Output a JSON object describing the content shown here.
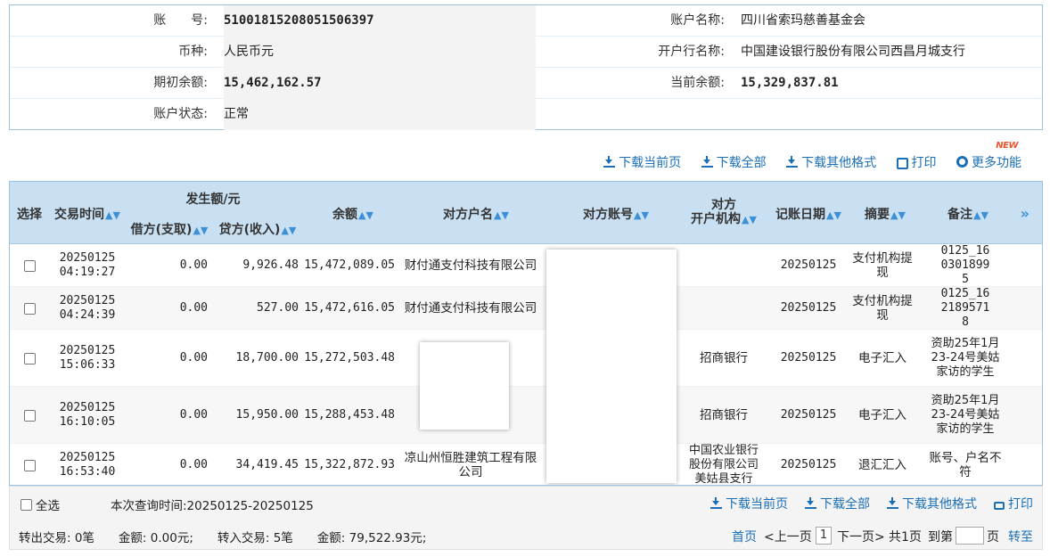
{
  "account": {
    "number_label": "账　　号:",
    "number": "51001815208051506397",
    "name_label": "账户名称:",
    "name": "四川省索玛慈善基金会",
    "currency_label": "币种:",
    "currency": "人民币元",
    "bank_label": "开户行名称:",
    "bank": "中国建设银行股份有限公司西昌月城支行",
    "opening_label": "期初余额:",
    "opening": "15,462,162.57",
    "current_label": "当前余额:",
    "current": "15,329,837.81",
    "status_label": "账户状态:",
    "status": "正常"
  },
  "toolbar": {
    "new_badge": "NEW",
    "download_page": "下载当前页",
    "download_all": "下载全部",
    "download_other": "下载其他格式",
    "print": "打印",
    "more": "更多功能"
  },
  "table": {
    "headers": {
      "select": "选择",
      "time": "交易时间",
      "amount_group": "发生额/元",
      "debit": "借方(支取)",
      "credit": "贷方(收入)",
      "balance": "余额",
      "counter_name": "对方户名",
      "counter_account": "对方账号",
      "counter_bank_1": "对方",
      "counter_bank_2": "开户机构",
      "book_date": "记账日期",
      "summary": "摘要",
      "remark": "备注",
      "expand": "»"
    },
    "rows": [
      {
        "date": "20250125",
        "time": "04:19:27",
        "debit": "0.00",
        "credit": "9,926.48",
        "balance": "15,472,089.05",
        "name": "财付通支付科技有限公司",
        "bank": "",
        "book": "20250125",
        "summary": "支付机构提现",
        "remark": "0125_1603018995"
      },
      {
        "date": "20250125",
        "time": "04:24:39",
        "debit": "0.00",
        "credit": "527.00",
        "balance": "15,472,616.05",
        "name": "财付通支付科技有限公司",
        "bank": "",
        "book": "20250125",
        "summary": "支付机构提现",
        "remark": "0125_1621895718"
      },
      {
        "date": "20250125",
        "time": "15:06:33",
        "debit": "0.00",
        "credit": "18,700.00",
        "balance": "15,272,503.48",
        "name": "",
        "bank": "招商银行",
        "book": "20250125",
        "summary": "电子汇入",
        "remark": "资助25年1月23-24号美姑家访的学生"
      },
      {
        "date": "20250125",
        "time": "16:10:05",
        "debit": "0.00",
        "credit": "15,950.00",
        "balance": "15,288,453.48",
        "name": "",
        "bank": "招商银行",
        "book": "20250125",
        "summary": "电子汇入",
        "remark": "资助25年1月23-24号美姑家访的学生"
      },
      {
        "date": "20250125",
        "time": "16:53:40",
        "debit": "0.00",
        "credit": "34,419.45",
        "balance": "15,322,872.93",
        "name": "凉山州恒胜建筑工程有限公司",
        "bank": "中国农业银行股份有限公司美姑县支行",
        "book": "20250125",
        "summary": "退汇汇入",
        "remark": "账号、户名不符"
      }
    ]
  },
  "footer": {
    "select_all": "全选",
    "query_time": "本次查询时间:20250125-20250125",
    "download_page": "下载当前页",
    "download_all": "下载全部",
    "download_other": "下载其他格式",
    "print": "打印",
    "summary": "转出交易: 0笔　　金额: 0.00元;　　转入交易: 5笔　　金额: 79,522.93元;",
    "first": "首页",
    "prev": "<上一页",
    "current_page": "1",
    "next": "下一页>",
    "total": "共1页",
    "goto_label": "到第",
    "page_unit": "页",
    "goto": "转至"
  }
}
